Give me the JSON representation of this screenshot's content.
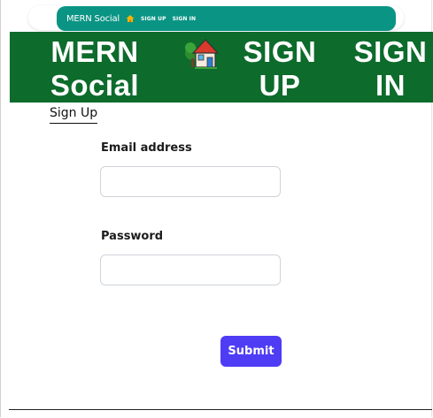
{
  "mini_nav": {
    "brand": "MERN Social",
    "links": [
      "SIGN UP",
      "SIGN IN"
    ],
    "color": "#0a9484"
  },
  "big_nav": {
    "brand_line1": "MERN",
    "brand_line2": "Social",
    "signup_line1": "SIGN",
    "signup_line2": "UP",
    "signin_line1": "SIGN",
    "signin_line2": "IN",
    "home_icon": "home-icon",
    "color": "#0d6b2c"
  },
  "form": {
    "title": "Sign Up",
    "email_label": "Email address",
    "email_value": "",
    "password_label": "Password",
    "password_value": "",
    "submit_label": "Submit",
    "submit_color": "#4f3cf5"
  }
}
